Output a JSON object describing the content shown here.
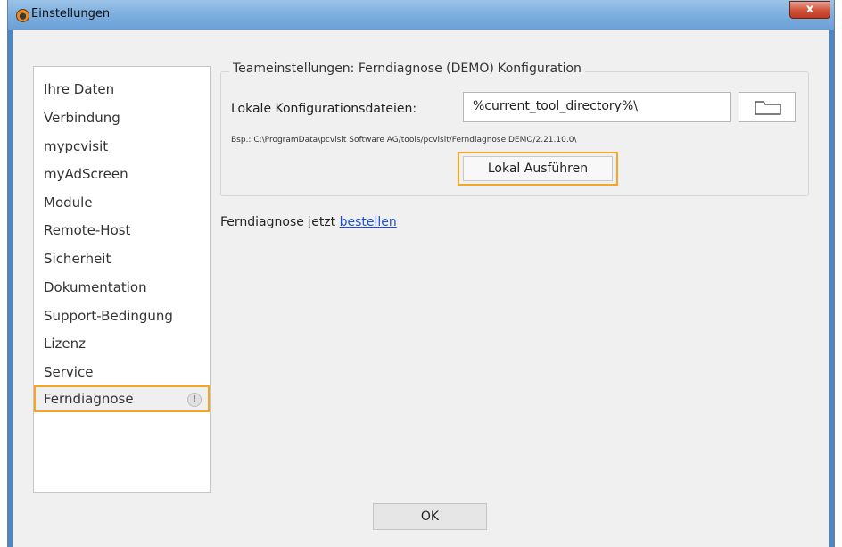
{
  "window": {
    "title": "Einstellungen",
    "close_label": "x"
  },
  "sidebar": {
    "items": [
      {
        "label": "Ihre Daten"
      },
      {
        "label": "Verbindung"
      },
      {
        "label": "mypcvisit"
      },
      {
        "label": "myAdScreen"
      },
      {
        "label": "Module"
      },
      {
        "label": "Remote-Host"
      },
      {
        "label": "Sicherheit"
      },
      {
        "label": "Dokumentation"
      },
      {
        "label": "Support-Bedingung"
      },
      {
        "label": "Lizenz"
      },
      {
        "label": "Service"
      },
      {
        "label": "Ferndiagnose",
        "badge": "!"
      }
    ],
    "active": "Ferndiagnose"
  },
  "group": {
    "title": "Teameinstellungen: Ferndiagnose (DEMO) Konfiguration",
    "config_label": "Lokale Konfigurationsdateien:",
    "config_value": "%current_tool_directory%\\",
    "hint": "Bsp.: C:\\ProgramData\\pcvisit Software AG/tools/pcvisit/Ferndiagnose DEMO/2.21.10.0\\",
    "run_label": "Lokal Ausführen"
  },
  "order": {
    "prefix": "Ferndiagnose jetzt ",
    "link": "bestellen"
  },
  "footer": {
    "ok_label": "OK"
  },
  "colors": {
    "highlight": "#f5a623",
    "link": "#1a4fd6",
    "titlebar": "#7fb0df"
  },
  "icons": {
    "app": "app-icon",
    "folder": "folder-icon",
    "warning": "warning-icon",
    "close": "close-icon"
  }
}
